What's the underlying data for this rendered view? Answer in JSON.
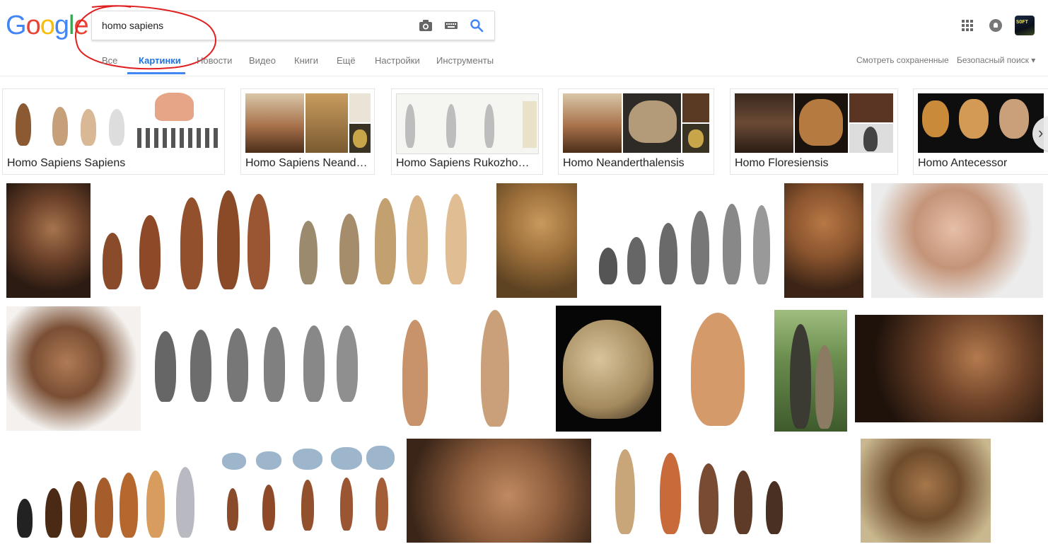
{
  "search": {
    "query": "homo sapiens"
  },
  "logo": {
    "letters": [
      "G",
      "o",
      "o",
      "g",
      "l",
      "e"
    ],
    "colors": [
      "#4285f4",
      "#ea4335",
      "#fbbc05",
      "#4285f4",
      "#34a853",
      "#ea4335"
    ]
  },
  "tabs": [
    {
      "label": "Все"
    },
    {
      "label": "Картинки"
    },
    {
      "label": "Новости"
    },
    {
      "label": "Видео"
    },
    {
      "label": "Книги"
    },
    {
      "label": "Ещё"
    },
    {
      "label": "Настройки"
    },
    {
      "label": "Инструменты"
    }
  ],
  "right_links": {
    "saved": "Смотреть сохраненные",
    "safesearch": "Безопасный поиск ▾"
  },
  "avatar": {
    "text": "SOFT"
  },
  "suggestions": [
    {
      "label": "Homo Sapiens Sapiens"
    },
    {
      "label": "Homo Sapiens Neand…"
    },
    {
      "label": "Homo Sapiens Rukozho…"
    },
    {
      "label": "Homo Neanderthalensis"
    },
    {
      "label": "Homo Floresiensis"
    },
    {
      "label": "Homo Antecessor"
    }
  ],
  "colors": {
    "accent": "#4285f4",
    "annotation": "#e02020",
    "tab_text": "#777777"
  }
}
